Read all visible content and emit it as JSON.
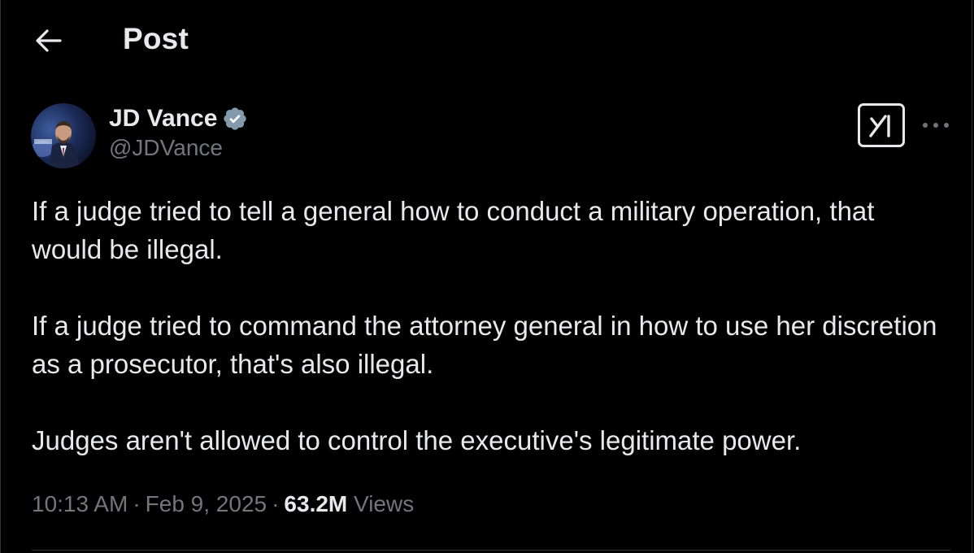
{
  "header": {
    "title": "Post",
    "back_icon": "arrow-left-icon"
  },
  "author": {
    "display_name": "JD Vance",
    "handle": "@JDVance",
    "verified": true,
    "verified_color": "#829aab",
    "avatar_icon": "profile-photo"
  },
  "actions": {
    "grok_icon": "grok-icon",
    "more_icon": "more-horizontal-icon"
  },
  "post": {
    "paragraphs": [
      "If a judge tried to tell a general how to conduct a military operation, that would be illegal.",
      "If a judge tried to command the attorney general in how to use her discretion as a prosecutor, that's also illegal.",
      "Judges aren't allowed to control the executive's legitimate power."
    ]
  },
  "meta": {
    "time": "10:13 AM",
    "separator": "·",
    "date": "Feb 9, 2025",
    "views_count": "63.2M",
    "views_label": "Views"
  },
  "colors": {
    "background": "#000000",
    "text_primary": "#e7e9ea",
    "text_secondary": "#71767b",
    "border": "#2f3336"
  }
}
